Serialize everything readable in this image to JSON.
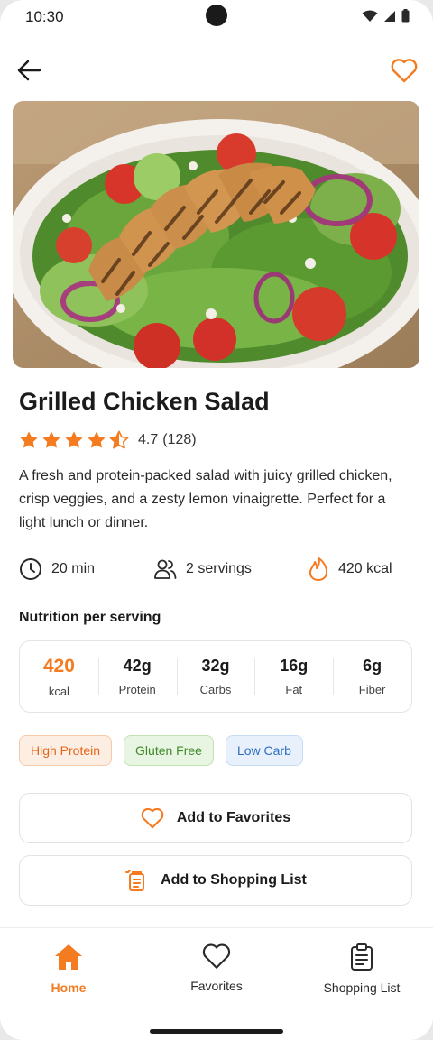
{
  "status_bar": {
    "time": "10:30"
  },
  "recipe": {
    "title": "Grilled Chicken Salad",
    "rating": "4.7",
    "rating_count": "(128)",
    "stars": 4.5,
    "description": "A fresh and protein-packed salad with juicy grilled chicken, crisp veggies, and a zesty lemon vinaigrette. Perfect for a light lunch or dinner.",
    "time": "20 min",
    "servings": "2 servings",
    "calories": "420 kcal"
  },
  "nutrition": {
    "title": "Nutrition per serving",
    "items": [
      {
        "value": "420",
        "label": "kcal"
      },
      {
        "value": "42g",
        "label": "Protein"
      },
      {
        "value": "32g",
        "label": "Carbs"
      },
      {
        "value": "16g",
        "label": "Fat"
      },
      {
        "value": "6g",
        "label": "Fiber"
      }
    ]
  },
  "tags": [
    "High Protein",
    "Gluten Free",
    "Low Carb"
  ],
  "actions": {
    "favorites": "Add to Favorites",
    "shopping": "Add to Shopping List"
  },
  "nav": [
    {
      "label": "Home",
      "icon": "home-icon",
      "active": true
    },
    {
      "label": "Favorites",
      "icon": "heart-icon",
      "active": false
    },
    {
      "label": "Shopping List",
      "icon": "clipboard-icon",
      "active": false
    }
  ],
  "colors": {
    "accent": "#f47b20",
    "tag_green": "#3f8a2a",
    "tag_blue": "#2f6fbf"
  }
}
